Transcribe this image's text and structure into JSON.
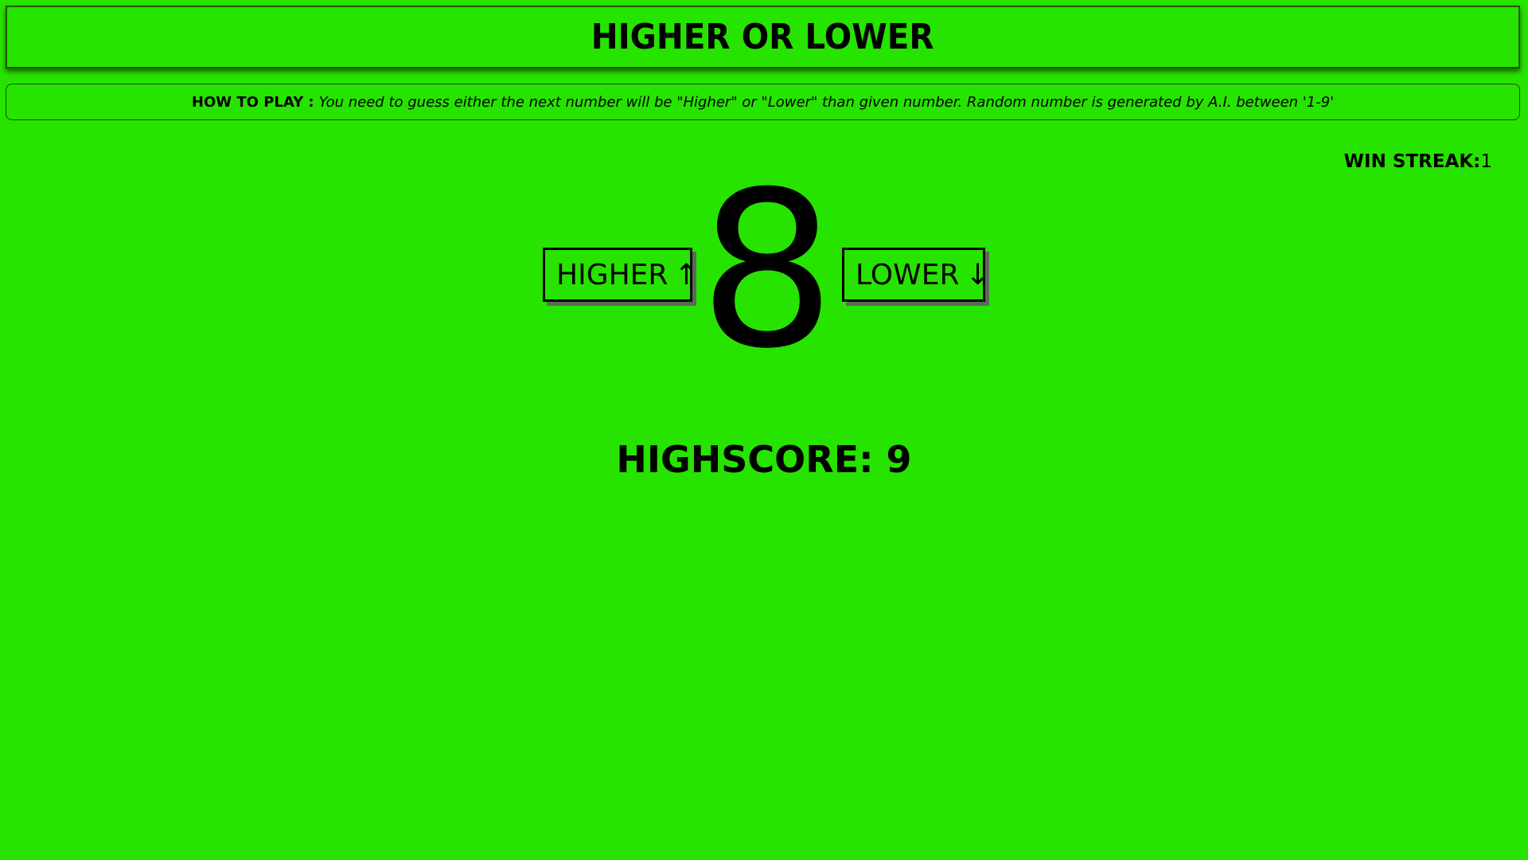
{
  "header": {
    "title": "HIGHER OR LOWER"
  },
  "instructions": {
    "label": "HOW TO PLAY :",
    "text": "You need to guess either the next number will be \"Higher\" or \"Lower\" than given number. Random number is generated by A.I. between '1-9'"
  },
  "stats": {
    "win_streak_label": "WIN STREAK:",
    "win_streak_value": "1",
    "highscore_label": "HIGHSCORE:",
    "highscore_value": "9"
  },
  "game": {
    "current_number": "8",
    "higher_label": "HIGHER",
    "higher_arrow": "↑",
    "lower_label": "LOWER",
    "lower_arrow": "↓"
  },
  "colors": {
    "background": "#27e400",
    "text": "#000000",
    "button_shadow": "#5a6b55"
  }
}
